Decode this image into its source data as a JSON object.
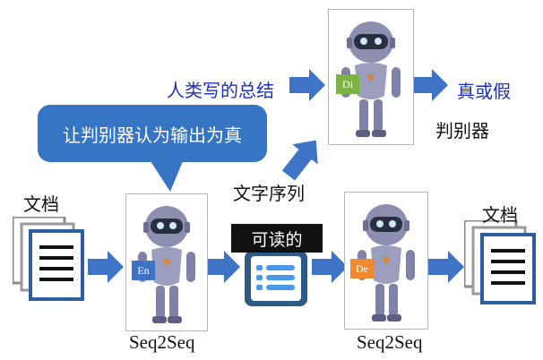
{
  "labels": {
    "human_summary": "人类写的总结",
    "true_or_false": "真或假",
    "discriminator": "判别器",
    "speech_bubble": "让判别器认为输出为真",
    "word_sequence": "文字序列",
    "document_left": "文档",
    "document_right": "文档",
    "readable": "可读的",
    "seq2seq_left": "Seq2Seq",
    "seq2seq_right": "Seq2Seq"
  },
  "tags": {
    "discriminator": "Di",
    "encoder": "En",
    "decoder": "De"
  },
  "colors": {
    "arrow": "#3f73c5",
    "bubble": "#3675c4",
    "tag_di": "#7cb342",
    "tag_en": "#3f73c5",
    "tag_de": "#f08a30",
    "doc_frame": "#8a8a8a",
    "doc_front": "#2f5f9a"
  }
}
